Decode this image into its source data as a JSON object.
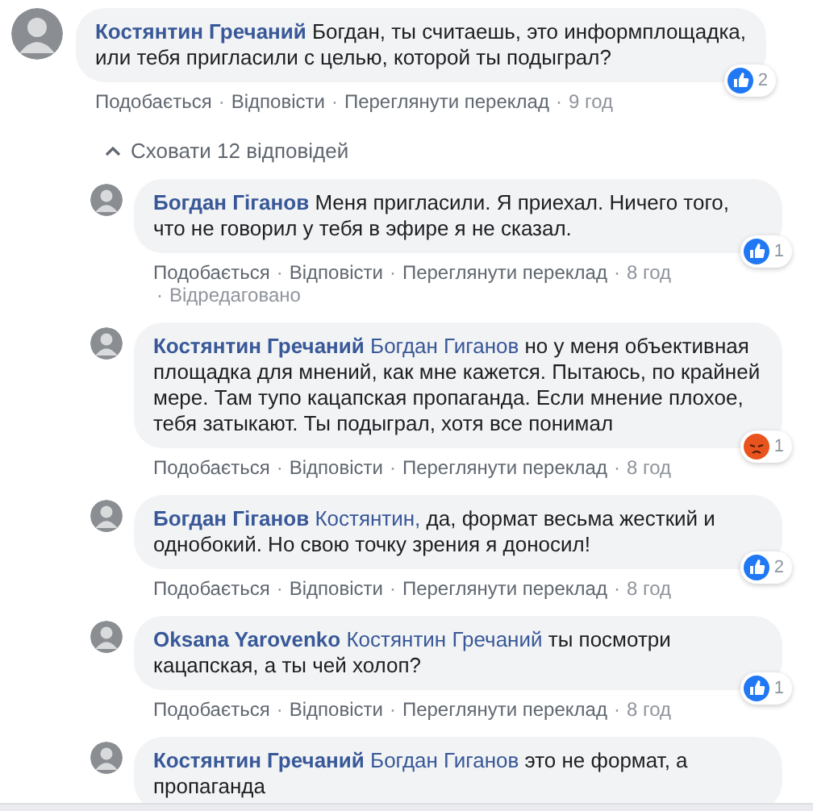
{
  "separator": "·",
  "comment": {
    "author": "Костянтин Гречаний",
    "text": "Богдан, ты считаешь, это информплощадка, или тебя пригласили с целью, которой ты подыграл?",
    "reaction": {
      "kind": "like",
      "count": "2"
    },
    "actions": [
      "Подобається",
      "Відповісти",
      "Переглянути переклад"
    ],
    "time": "9 год"
  },
  "toggle": {
    "label": "Сховати 12 відповідей",
    "expanded": true
  },
  "replies": [
    {
      "author": "Богдан Гiганов",
      "text": "Меня пригласили. Я приехал. Ничего того, что не говорил у тебя в эфире я не сказал.",
      "reaction": {
        "kind": "like",
        "count": "1"
      },
      "actions": [
        "Подобається",
        "Відповісти",
        "Переглянути переклад"
      ],
      "time": "8 год",
      "edited": "Відредаговано"
    },
    {
      "author": "Костянтин Гречаний",
      "mention": "Богдан Гиганов",
      "text": "но у меня объективная площадка для мнений, как мне кажется. Пытаюсь, по крайней мере. Там тупо кацапская пропаганда. Если мнение плохое, тебя затыкают. Ты подыграл, хотя все понимал",
      "reaction": {
        "kind": "angry",
        "count": "1"
      },
      "actions": [
        "Подобається",
        "Відповісти",
        "Переглянути переклад"
      ],
      "time": "8 год"
    },
    {
      "author": "Богдан Гiганов",
      "mention": "Костянтин,",
      "text": "да, формат весьма жесткий и однобокий. Но свою точку зрения я доносил!",
      "reaction": {
        "kind": "like",
        "count": "2"
      },
      "actions": [
        "Подобається",
        "Відповісти",
        "Переглянути переклад"
      ],
      "time": "8 год"
    },
    {
      "author": "Oksana Yarovenko",
      "mention": "Костянтин Гречаний",
      "text": "ты посмотри кацапская, а ты чей холоп?",
      "reaction": {
        "kind": "like",
        "count": "1"
      },
      "actions": [
        "Подобається",
        "Відповісти",
        "Переглянути переклад"
      ],
      "time": "8 год"
    },
    {
      "author": "Костянтин Гречаний",
      "mention": "Богдан Гиганов",
      "text": "это не формат, а пропаганда"
    }
  ]
}
